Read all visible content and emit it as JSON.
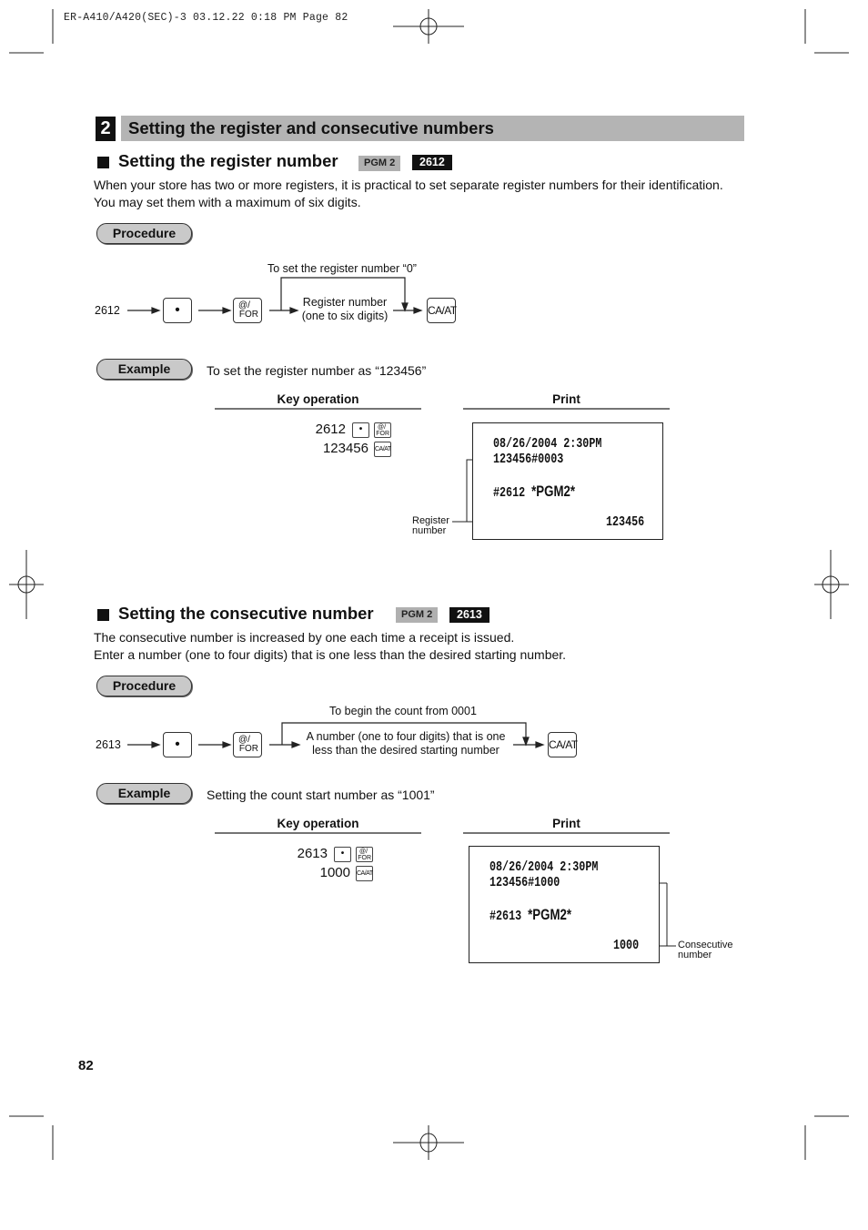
{
  "print_header": "ER-A410/A420(SEC)-3  03.12.22 0:18 PM  Page 82",
  "section": {
    "number": "2",
    "title": "Setting the register and consecutive numbers"
  },
  "register": {
    "title": "Setting the register number",
    "mode_tag": "PGM 2",
    "code_tag": "2612",
    "description": [
      "When your store has two or more registers, it is practical to set separate register numbers for their identification.",
      "You may set them with a maximum of six digits."
    ],
    "procedure_label": "Procedure",
    "flow": {
      "start": "2612",
      "dot_key": "•",
      "for_key_top": "@/",
      "for_key_bottom": "FOR",
      "bypass_label": "To set the register number “0”",
      "input_line1": "Register number",
      "input_line2": "(one to six digits)",
      "end_key": "CA/AT"
    },
    "example_label": "Example",
    "example_text": "To set the register number as “123456”",
    "key_operation_header": "Key operation",
    "print_header": "Print",
    "key_ops": [
      {
        "value": "2612",
        "keys": [
          "dot",
          "for"
        ]
      },
      {
        "value": "123456",
        "keys": [
          "ca"
        ]
      }
    ],
    "receipt": {
      "line1": "08/26/2004  2:30PM",
      "line2": "123456#0003",
      "line3_prefix": "#2612",
      "line3_mode": "*PGM2*",
      "line4": "123456"
    },
    "callout_line1": "Register",
    "callout_line2": "number"
  },
  "consecutive": {
    "title": "Setting the consecutive number",
    "mode_tag": "PGM 2",
    "code_tag": "2613",
    "description": [
      "The consecutive number is increased by one each time a receipt is issued.",
      "Enter a number (one to four digits) that is one less than the desired starting number."
    ],
    "procedure_label": "Procedure",
    "flow": {
      "start": "2613",
      "dot_key": "•",
      "for_key_top": "@/",
      "for_key_bottom": "FOR",
      "bypass_label": "To begin the count from 0001",
      "input_line1": "A number (one to four digits) that is one",
      "input_line2": "less than the desired starting number",
      "end_key": "CA/AT"
    },
    "example_label": "Example",
    "example_text": "Setting the count start number as “1001”",
    "key_operation_header": "Key operation",
    "print_header": "Print",
    "key_ops": [
      {
        "value": "2613",
        "keys": [
          "dot",
          "for"
        ]
      },
      {
        "value": "1000",
        "keys": [
          "ca"
        ]
      }
    ],
    "receipt": {
      "line1": "08/26/2004  2:30PM",
      "line2": "123456#1000",
      "line3_prefix": "#2613",
      "line3_mode": "*PGM2*",
      "line4": "1000"
    },
    "callout_line1": "Consecutive",
    "callout_line2": "number"
  },
  "page_number": "82",
  "keys": {
    "dot": "•",
    "for_top": "@/",
    "for_bottom": "FOR",
    "ca": "CA/AT"
  }
}
